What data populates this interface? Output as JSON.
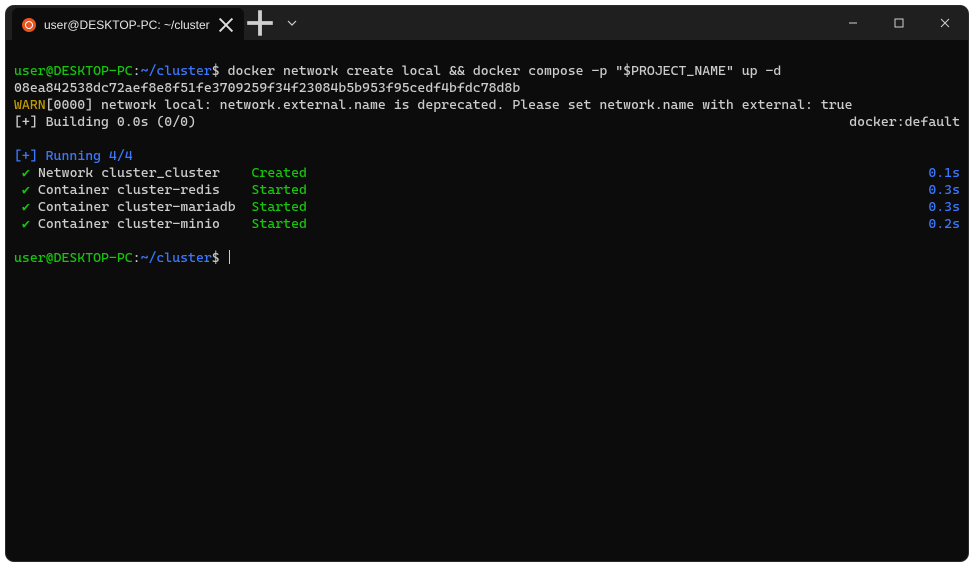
{
  "titlebar": {
    "tab_title": "user@DESKTOP-PC: ~/cluster"
  },
  "prompt": {
    "user_host": "user@DESKTOP-PC",
    "colon": ":",
    "path": "~/cluster",
    "symbol": "$"
  },
  "lines": {
    "cmd1": " docker network create local && docker compose -p \"$PROJECT_NAME\" up -d",
    "hash": "08ea842538dc72aef8e8f51fe3709259f34f23084b5b953f95cedf4bfdc78d8b",
    "warn_tag": "WARN",
    "warn_code": "[0000]",
    "warn_msg": " network local: network.external.name is deprecated. Please set network.name with external: true",
    "building_left": "[+] Building 0.0s (0/0)",
    "building_right": "docker:default",
    "running": "[+] Running 4/4"
  },
  "items": [
    {
      "name": "Network cluster_cluster",
      "state": "Created",
      "time": "0.1s"
    },
    {
      "name": "Container cluster-redis",
      "state": "Started",
      "time": "0.3s"
    },
    {
      "name": "Container cluster-mariadb",
      "state": "Started",
      "time": "0.3s"
    },
    {
      "name": "Container cluster-minio",
      "state": "Started",
      "time": "0.2s"
    }
  ]
}
